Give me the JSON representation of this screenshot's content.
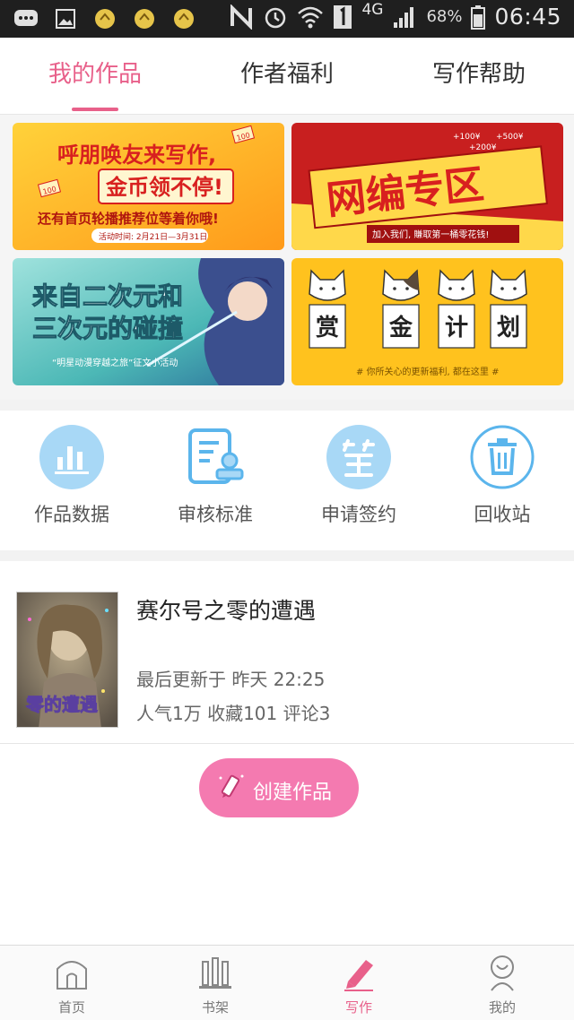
{
  "status_bar": {
    "network_label": "4G",
    "battery": "68%",
    "time": "06:45"
  },
  "tabs": [
    {
      "label": "我的作品",
      "active": true
    },
    {
      "label": "作者福利",
      "active": false
    },
    {
      "label": "写作帮助",
      "active": false
    }
  ],
  "banners": [
    {
      "id": "invite",
      "line1": "呼朋唤友来写作,",
      "line2": "金币领不停!",
      "line3": "还有首页轮播推荐位等着你哦!",
      "date": "活动时间: 2月21日—3月31日",
      "badge": "100"
    },
    {
      "id": "editor",
      "title": "网编专区",
      "sub": "加入我们, 賺取第一桶零花钱!",
      "deco1": "+100¥",
      "deco2": "+500¥",
      "deco3": "+200¥"
    },
    {
      "id": "anime",
      "title1": "来自二次元和",
      "title2": "三次元的碰撞",
      "sub": "“明星动漫穿越之旅”征文小活动"
    },
    {
      "id": "reward",
      "chars": [
        "赏",
        "金",
        "计",
        "划"
      ],
      "sub": "# 你所关心的更新福利, 都在这里 #"
    }
  ],
  "quick_actions": [
    {
      "label": "作品数据",
      "icon": "bar-chart-icon"
    },
    {
      "label": "审核标准",
      "icon": "review-document-icon"
    },
    {
      "label": "申请签约",
      "icon": "sign-contract-icon"
    },
    {
      "label": "回收站",
      "icon": "trash-icon"
    }
  ],
  "work": {
    "title": "赛尔号之零的遭遇",
    "updated": "最后更新于 昨天 22:25",
    "stats": "人气1万 收藏101 评论3",
    "cover_text": "零的遭遇"
  },
  "create_button": {
    "label": "创建作品"
  },
  "bottom_nav": [
    {
      "label": "首页",
      "icon": "home-icon",
      "active": false
    },
    {
      "label": "书架",
      "icon": "bookshelf-icon",
      "active": false
    },
    {
      "label": "写作",
      "icon": "pen-icon",
      "active": true
    },
    {
      "label": "我的",
      "icon": "profile-icon",
      "active": false
    }
  ],
  "colors": {
    "accent": "#e8608a",
    "create_button": "#f47ab0",
    "icon_blue": "#5bb5ec"
  }
}
